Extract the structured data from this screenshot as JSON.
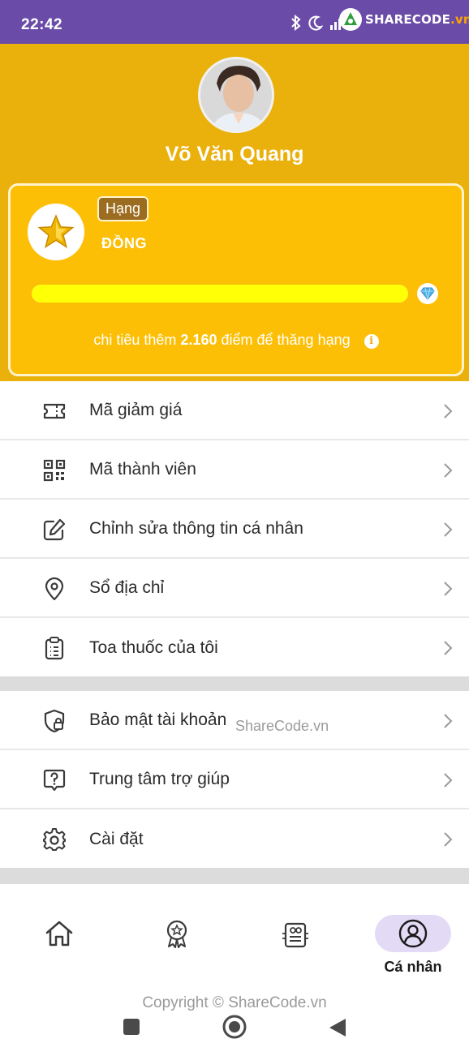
{
  "status_bar": {
    "time": "22:42",
    "icons": [
      "bluetooth-icon",
      "moon-icon",
      "alarm-icon",
      "signal-icon",
      "wifi-icon",
      "battery-icon"
    ]
  },
  "watermark": {
    "logo_text_main": "SHARECODE",
    "logo_text_suffix": ".vn",
    "center_text": "ShareCode.vn",
    "copyright": "Copyright © ShareCode.vn"
  },
  "profile": {
    "name": "Võ Văn Quang"
  },
  "rank": {
    "tag": "Hạng",
    "level": "ĐỒNG",
    "progress": 1.0,
    "upgrade_prefix": "chi tiêu thêm",
    "upgrade_points": "2.160",
    "upgrade_suffix": "điểm để thăng hạng"
  },
  "menu_primary": [
    {
      "label": "Mã giảm giá",
      "icon": "ticket-icon"
    },
    {
      "label": "Mã thành viên",
      "icon": "qr-code-icon"
    },
    {
      "label": "Chỉnh sửa thông tin cá nhân",
      "icon": "edit-icon"
    },
    {
      "label": "Sổ địa chỉ",
      "icon": "location-pin-icon"
    },
    {
      "label": "Toa thuốc của tôi",
      "icon": "clipboard-icon"
    }
  ],
  "menu_secondary": [
    {
      "label": "Bảo mật tài khoản",
      "icon": "shield-lock-icon"
    },
    {
      "label": "Trung tâm trợ giúp",
      "icon": "help-icon"
    },
    {
      "label": "Cài đặt",
      "icon": "gear-icon"
    }
  ],
  "bottom_nav": [
    {
      "label": "",
      "icon": "home-icon",
      "active": false
    },
    {
      "label": "",
      "icon": "award-icon",
      "active": false
    },
    {
      "label": "",
      "icon": "prescription-icon",
      "active": false
    },
    {
      "label": "Cá nhân",
      "icon": "user-icon",
      "active": true
    }
  ],
  "colors": {
    "status_bar": "#6a4ca8",
    "header": "#eab00b",
    "card": "#fcbf06",
    "progress": "#ffff06",
    "active_pill": "#e3dbf6"
  }
}
